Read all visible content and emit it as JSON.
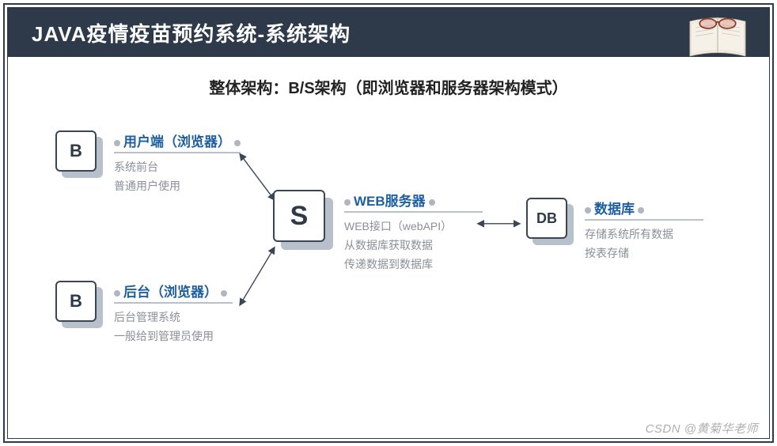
{
  "header": {
    "title": "JAVA疫情疫苗预约系统-系统架构"
  },
  "subtitle": "整体架构：B/S架构（即浏览器和服务器架构模式）",
  "nodes": {
    "client": {
      "badge": "B",
      "title": "用户端（浏览器）",
      "desc1": "系统前台",
      "desc2": "普通用户使用"
    },
    "admin": {
      "badge": "B",
      "title": "后台（浏览器）",
      "desc1": "后台管理系统",
      "desc2": "一般给到管理员使用"
    },
    "server": {
      "badge": "S",
      "title": "WEB服务器",
      "desc1": "WEB接口（webAPI）",
      "desc2": "从数据库获取数据",
      "desc3": "传递数据到数据库"
    },
    "db": {
      "badge": "DB",
      "title": "数据库",
      "desc1": "存储系统所有数据",
      "desc2": "按表存储"
    }
  },
  "watermark": "CSDN @黄菊华老师"
}
